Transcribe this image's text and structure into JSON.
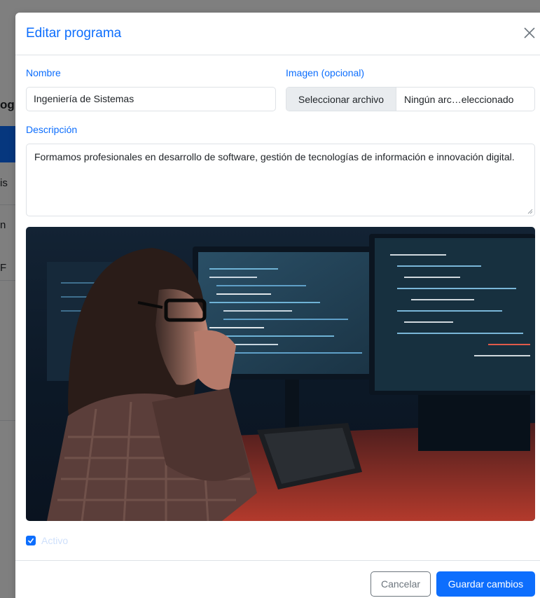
{
  "background": {
    "fragments": [
      "og",
      "is",
      "n",
      "F"
    ]
  },
  "modal": {
    "title": "Editar programa",
    "close_icon": "close-icon"
  },
  "form": {
    "nombre_label": "Nombre",
    "nombre_value": "Ingeniería de Sistemas",
    "imagen_label": "Imagen (opcional)",
    "file_button_label": "Seleccionar archivo",
    "file_name": "Ningún arc…eleccionado",
    "descripcion_label": "Descripción",
    "descripcion_value": "Formamos profesionales en desarrollo de software, gestión de tecnologías de información e innovación digital.",
    "activo_label": "Activo",
    "activo_checked": true
  },
  "footer": {
    "cancel_label": "Cancelar",
    "save_label": "Guardar cambios"
  },
  "colors": {
    "primary": "#0d6efd",
    "secondary": "#6c757d"
  }
}
